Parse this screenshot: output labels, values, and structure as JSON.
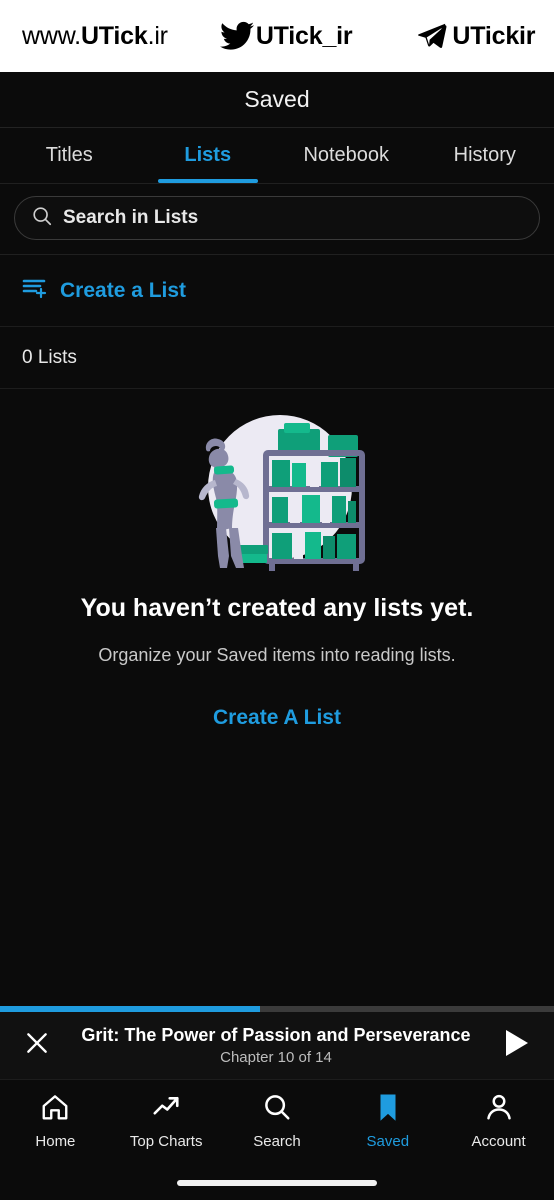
{
  "watermark": {
    "site": "www.UTick.ir",
    "site_plain": "www.",
    "site_bold": "UTick",
    "site_tld": ".ir",
    "twitter_handle": "UTick_ir",
    "telegram_handle": "UTickir",
    "twitter_icon": "twitter-bird-icon",
    "telegram_icon": "telegram-plane-icon"
  },
  "header": {
    "title": "Saved"
  },
  "tabs": [
    {
      "label": "Titles",
      "active": false
    },
    {
      "label": "Lists",
      "active": true
    },
    {
      "label": "Notebook",
      "active": false
    },
    {
      "label": "History",
      "active": false
    }
  ],
  "search": {
    "placeholder": "Search in Lists",
    "value": "",
    "icon": "search-icon"
  },
  "create_list_row": {
    "label": "Create a List",
    "icon": "list-add-icon"
  },
  "list_count": {
    "label": "0 Lists",
    "count": 0
  },
  "empty_state": {
    "illustration": "bookshelf-person-illustration",
    "title": "You haven’t created any lists yet.",
    "subtitle": "Organize your Saved items into reading lists.",
    "cta": "Create A List"
  },
  "player": {
    "title": "Grit: The Power of Passion and Perseverance",
    "chapter": "Chapter 10 of 14",
    "progress_percent": 47,
    "close_icon": "close-icon",
    "play_icon": "play-icon"
  },
  "bottom_nav": [
    {
      "label": "Home",
      "icon": "home-icon",
      "active": false
    },
    {
      "label": "Top Charts",
      "icon": "trending-icon",
      "active": false
    },
    {
      "label": "Search",
      "icon": "search-icon",
      "active": false
    },
    {
      "label": "Saved",
      "icon": "bookmark-icon",
      "active": true
    },
    {
      "label": "Account",
      "icon": "person-icon",
      "active": false
    }
  ],
  "colors": {
    "accent": "#1f9cdf",
    "background": "#0b0b0b",
    "text_primary": "#ffffff",
    "text_secondary": "#c9c9c9",
    "illustration_green": "#07a07a",
    "illustration_gray": "#8a8aa8"
  }
}
